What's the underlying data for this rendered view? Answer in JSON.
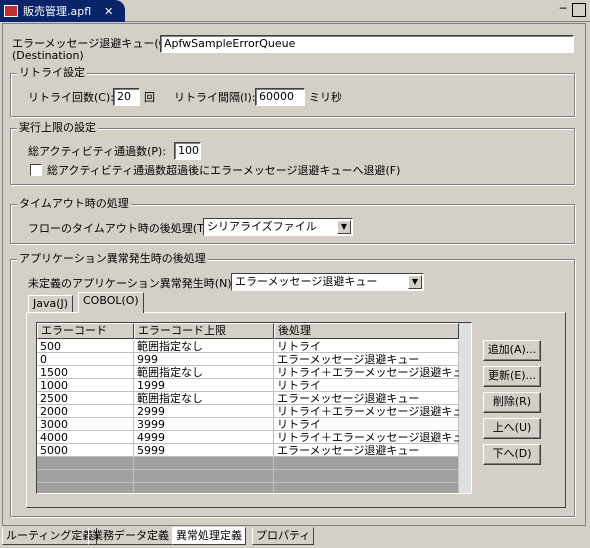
{
  "editor_tab": {
    "title": "販売管理.apfl",
    "close_label": "✕"
  },
  "window_controls": {
    "minimize": "─",
    "maximize": "□"
  },
  "error_queue": {
    "label": "エラーメッセージ退避キュー(Q):",
    "sub_label": "(Destination)",
    "value": "ApfwSampleErrorQueue"
  },
  "retry": {
    "group_title": "リトライ設定",
    "count_label": "リトライ回数(C):",
    "count_value": "20",
    "count_unit": "回",
    "interval_label": "リトライ間隔(I):",
    "interval_value": "60000",
    "interval_unit": "ミリ秒"
  },
  "exec_limit": {
    "group_title": "実行上限の設定",
    "total_label": "総アクティビティ通過数(P):",
    "total_value": "100",
    "checkbox_label": "総アクティビティ通過数超過後にエラーメッセージ退避キューへ退避(F)",
    "checkbox_checked": false
  },
  "timeout": {
    "group_title": "タイムアウト時の処理",
    "post_label": "フローのタイムアウト時の後処理(T):",
    "post_value": "シリアライズファイル"
  },
  "app_error": {
    "group_title": "アプリケーション異常発生時の後処理",
    "undef_label": "未定義のアプリケーション異常発生時(N):",
    "undef_value": "エラーメッセージ退避キュー",
    "tabs": [
      {
        "label": "Java(J)"
      },
      {
        "label": "COBOL(O)"
      }
    ],
    "columns": [
      "エラーコード",
      "エラーコード上限",
      "後処理"
    ],
    "rows": [
      [
        "500",
        "範囲指定なし",
        "リトライ"
      ],
      [
        "0",
        "999",
        "エラーメッセージ退避キュー"
      ],
      [
        "1500",
        "範囲指定なし",
        "リトライ＋エラーメッセージ退避キュー"
      ],
      [
        "1000",
        "1999",
        "リトライ"
      ],
      [
        "2500",
        "範囲指定なし",
        "エラーメッセージ退避キュー"
      ],
      [
        "2000",
        "2999",
        "リトライ＋エラーメッセージ退避キュー"
      ],
      [
        "3000",
        "3999",
        "リトライ"
      ],
      [
        "4000",
        "4999",
        "リトライ＋エラーメッセージ退避キュー"
      ],
      [
        "5000",
        "5999",
        "エラーメッセージ退避キュー"
      ]
    ],
    "buttons": {
      "add": "追加(A)...",
      "update": "更新(E)...",
      "delete": "削除(R)",
      "up": "上へ(U)",
      "down": "下へ(D)"
    }
  },
  "bottom_tabs": [
    "ルーティング定義",
    "業務データ定義",
    "異常処理定義",
    "プロパティ"
  ],
  "colors": {
    "accent": "#0a246a",
    "panel": "#d4d0c8"
  }
}
